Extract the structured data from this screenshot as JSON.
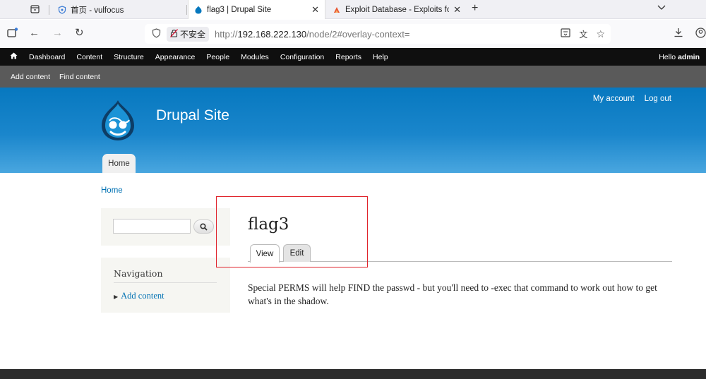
{
  "browser": {
    "tabs": [
      {
        "title": "首页 - vulfocus",
        "active": false,
        "closable": false
      },
      {
        "title": "flag3 | Drupal Site",
        "active": true,
        "closable": true
      },
      {
        "title": "Exploit Database - Exploits fo",
        "active": false,
        "closable": true
      }
    ],
    "address": {
      "insecure_label": "不安全",
      "url_prefix": "http://",
      "url_host": "192.168.222.130",
      "url_path": "/node/2#overlay-context="
    }
  },
  "admin_toolbar": {
    "items": [
      "Dashboard",
      "Content",
      "Structure",
      "Appearance",
      "People",
      "Modules",
      "Configuration",
      "Reports",
      "Help"
    ],
    "greeting": "Hello ",
    "user": "admin"
  },
  "shortcuts": [
    "Add content",
    "Find content"
  ],
  "site": {
    "name": "Drupal Site",
    "user_links": [
      "My account",
      "Log out"
    ],
    "primary_tab": "Home"
  },
  "breadcrumb": "Home",
  "search": {
    "value": "",
    "placeholder": ""
  },
  "navigation": {
    "title": "Navigation",
    "links": [
      "Add content"
    ]
  },
  "node": {
    "title": "flag3",
    "tabs": [
      "View",
      "Edit"
    ],
    "active_tab": "View",
    "body": "Special PERMS will help FIND the passwd - but you'll need to -exec that command to work out how to get what's in the shadow."
  },
  "colors": {
    "header_blue": "#0778bf",
    "link_blue": "#0071b3",
    "annotation_red": "#e0232b",
    "admin_bar": "#0f0f0f"
  }
}
